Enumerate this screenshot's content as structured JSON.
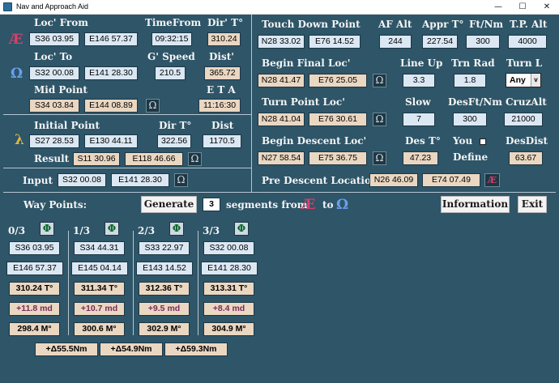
{
  "window": {
    "title": "Nav and Approach Aid",
    "min": "—",
    "max": "☐",
    "close": "✕"
  },
  "symbols": {
    "ae": "Æ",
    "omega": "Ω",
    "lambda": "λ",
    "phi": "Φ"
  },
  "colors": {
    "ae": "#d6416a",
    "omega": "#6b9ff0",
    "lambda": "#e3b93c"
  },
  "from": {
    "label": "Loc' From",
    "lat": "S36 03.95",
    "lon": "E146 57.37"
  },
  "time_from": {
    "label": "TimeFrom",
    "value": "09:32:15"
  },
  "dir_t": {
    "label": "Dir' T°",
    "value": "310.24"
  },
  "to": {
    "label": "Loc' To",
    "lat": "S32 00.08",
    "lon": "E141 28.30"
  },
  "g_speed": {
    "label": "G' Speed",
    "value": "210.5"
  },
  "dist": {
    "label": "Dist'",
    "value": "365.72"
  },
  "mid": {
    "label": "Mid Point",
    "lat": "S34 03.84",
    "lon": "E144 08.89"
  },
  "eta": {
    "label": "E T A",
    "value": "11:16:30"
  },
  "initial": {
    "label": "Initial Point",
    "lat": "S27 28.53",
    "lon": "E130 44.11",
    "dir_label": "Dir T°",
    "dir_value": "322.56",
    "dist_label": "Dist",
    "dist_value": "1170.5"
  },
  "result": {
    "label": "Result",
    "lat": "S11 30.96",
    "lon": "E118 46.66"
  },
  "input": {
    "label": "Input",
    "lat": "S32 00.08",
    "lon": "E141 28.30"
  },
  "touchdown": {
    "label": "Touch Down Point",
    "lat": "N28 33.02",
    "lon": "E76 14.52"
  },
  "af_alt": {
    "label": "AF Alt",
    "value": "244"
  },
  "appr_t": {
    "label": "Appr T°",
    "value": "227.54"
  },
  "ft_nm": {
    "label": "Ft/Nm",
    "value": "300"
  },
  "tp_alt": {
    "label": "T.P. Alt",
    "value": "4000"
  },
  "begin_final": {
    "label": "Begin Final Loc'",
    "lat": "N28 41.47",
    "lon": "E76 25.05"
  },
  "line_up": {
    "label": "Line Up",
    "value": "3.3"
  },
  "trn_rad": {
    "label": "Trn Rad",
    "value": "1.8"
  },
  "turn_l": {
    "label": "Turn  L",
    "value": "Any",
    "arrow": "v"
  },
  "turn_point": {
    "label": "Turn Point Loc'",
    "lat": "N28 41.04",
    "lon": "E76 30.61"
  },
  "slow": {
    "label": "Slow",
    "value": "7"
  },
  "desft_nm": {
    "label": "DesFt/Nm",
    "value": "300"
  },
  "cruz_alt": {
    "label": "CruzAlt",
    "value": "21000"
  },
  "begin_descent": {
    "label": "Begin Descent Loc'",
    "lat": "N27 58.54",
    "lon": "E75 36.75"
  },
  "des_t": {
    "label": "Des T°",
    "value": "47.23"
  },
  "you_define": {
    "you": "You",
    "define": "Define"
  },
  "des_dist": {
    "label": "DesDist",
    "value": "63.67"
  },
  "pre_descent": {
    "label": "Pre Descent Location",
    "lat": "N26 46.09",
    "lon": "E74 07.49"
  },
  "waypoints": {
    "label": "Way Points:",
    "generate": "Generate",
    "segments": "3",
    "segments_text": "segments from",
    "to_text": "to",
    "information": "Information",
    "exit": "Exit",
    "columns": [
      {
        "header": "0/3",
        "lat": "S36 03.95",
        "lon": "E146 57.37",
        "true": "310.24 T°",
        "md": "+11.8 md",
        "mag": "298.4 M°"
      },
      {
        "header": "1/3",
        "lat": "S34 44.31",
        "lon": "E145 04.14",
        "true": "311.34 T°",
        "md": "+10.7 md",
        "mag": "300.6 M°"
      },
      {
        "header": "2/3",
        "lat": "S33 22.97",
        "lon": "E143 14.52",
        "true": "312.36 T°",
        "md": "+9.5 md",
        "mag": "302.9 M°"
      },
      {
        "header": "3/3",
        "lat": "S32 00.08",
        "lon": "E141 28.30",
        "true": "313.31 T°",
        "md": "+8.4 md",
        "mag": "304.9 M°"
      }
    ],
    "deltas": [
      "+Δ55.5Nm",
      "+Δ54.9Nm",
      "+Δ59.3Nm"
    ]
  }
}
